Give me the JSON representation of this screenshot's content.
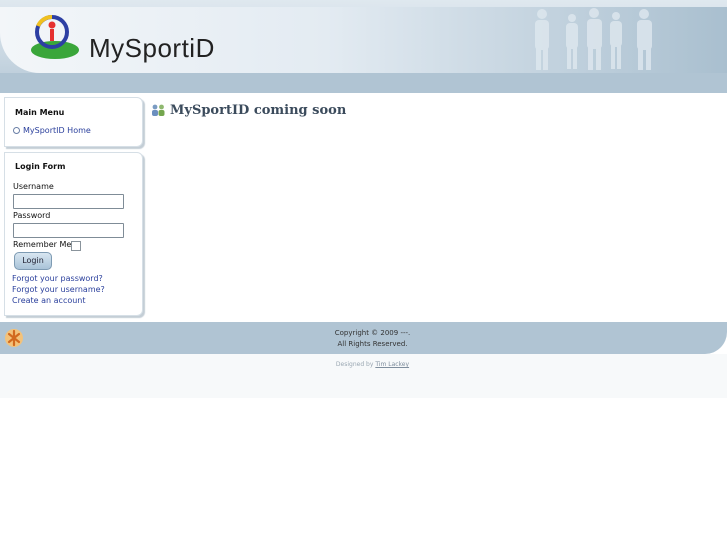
{
  "header": {
    "logo_text": "MySportiD"
  },
  "main_menu": {
    "title": "Main Menu",
    "items": [
      {
        "label": "MySportID Home"
      }
    ]
  },
  "login_form": {
    "title": "Login Form",
    "username_label": "Username",
    "password_label": "Password",
    "remember_label": "Remember Me",
    "login_button": "Login",
    "links": [
      "Forgot your password?",
      "Forgot your username?",
      "Create an account"
    ]
  },
  "main": {
    "heading": "MySportID coming soon"
  },
  "footer": {
    "copyright_line1": "Copyright © 2009 ---.",
    "copyright_line2": "All Rights Reserved.",
    "designed_prefix": "Designed by",
    "designer": "Tim Lackey"
  }
}
